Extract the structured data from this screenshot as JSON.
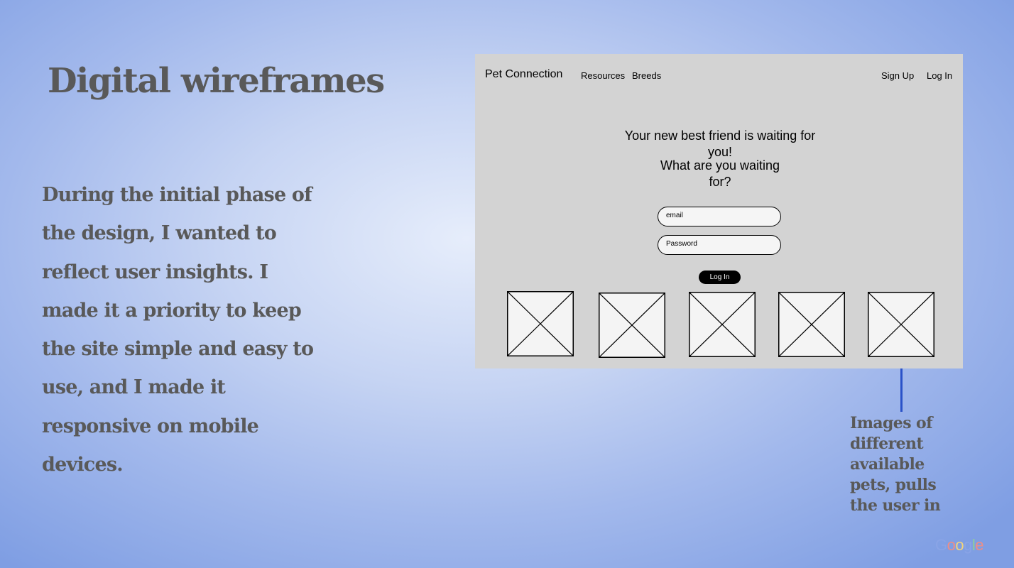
{
  "slide": {
    "title": "Digital wireframes",
    "body": "During the initial phase of the design, I wanted to reflect user insights. I made it a priority to keep the site simple and easy to use, and I made it responsive on mobile devices."
  },
  "wireframe": {
    "brand": "Pet Connection",
    "nav": {
      "resources": "Resources",
      "breeds": "Breeds",
      "sign_up": "Sign Up",
      "log_in": "Log In"
    },
    "headline_1": "Your new best friend is waiting for you!",
    "headline_2": "What are you waiting for?",
    "email_placeholder": "email",
    "password_placeholder": "Password",
    "login_button": "Log In"
  },
  "callout": {
    "text": "Images of different available pets, pulls the user in"
  },
  "branding": {
    "logo_letters": [
      "G",
      "o",
      "o",
      "g",
      "l",
      "e"
    ],
    "logo_colors": [
      "#8aa4e6",
      "#ee8e86",
      "#f1d37c",
      "#8aa4e6",
      "#8fce9a",
      "#ee8e86"
    ]
  }
}
